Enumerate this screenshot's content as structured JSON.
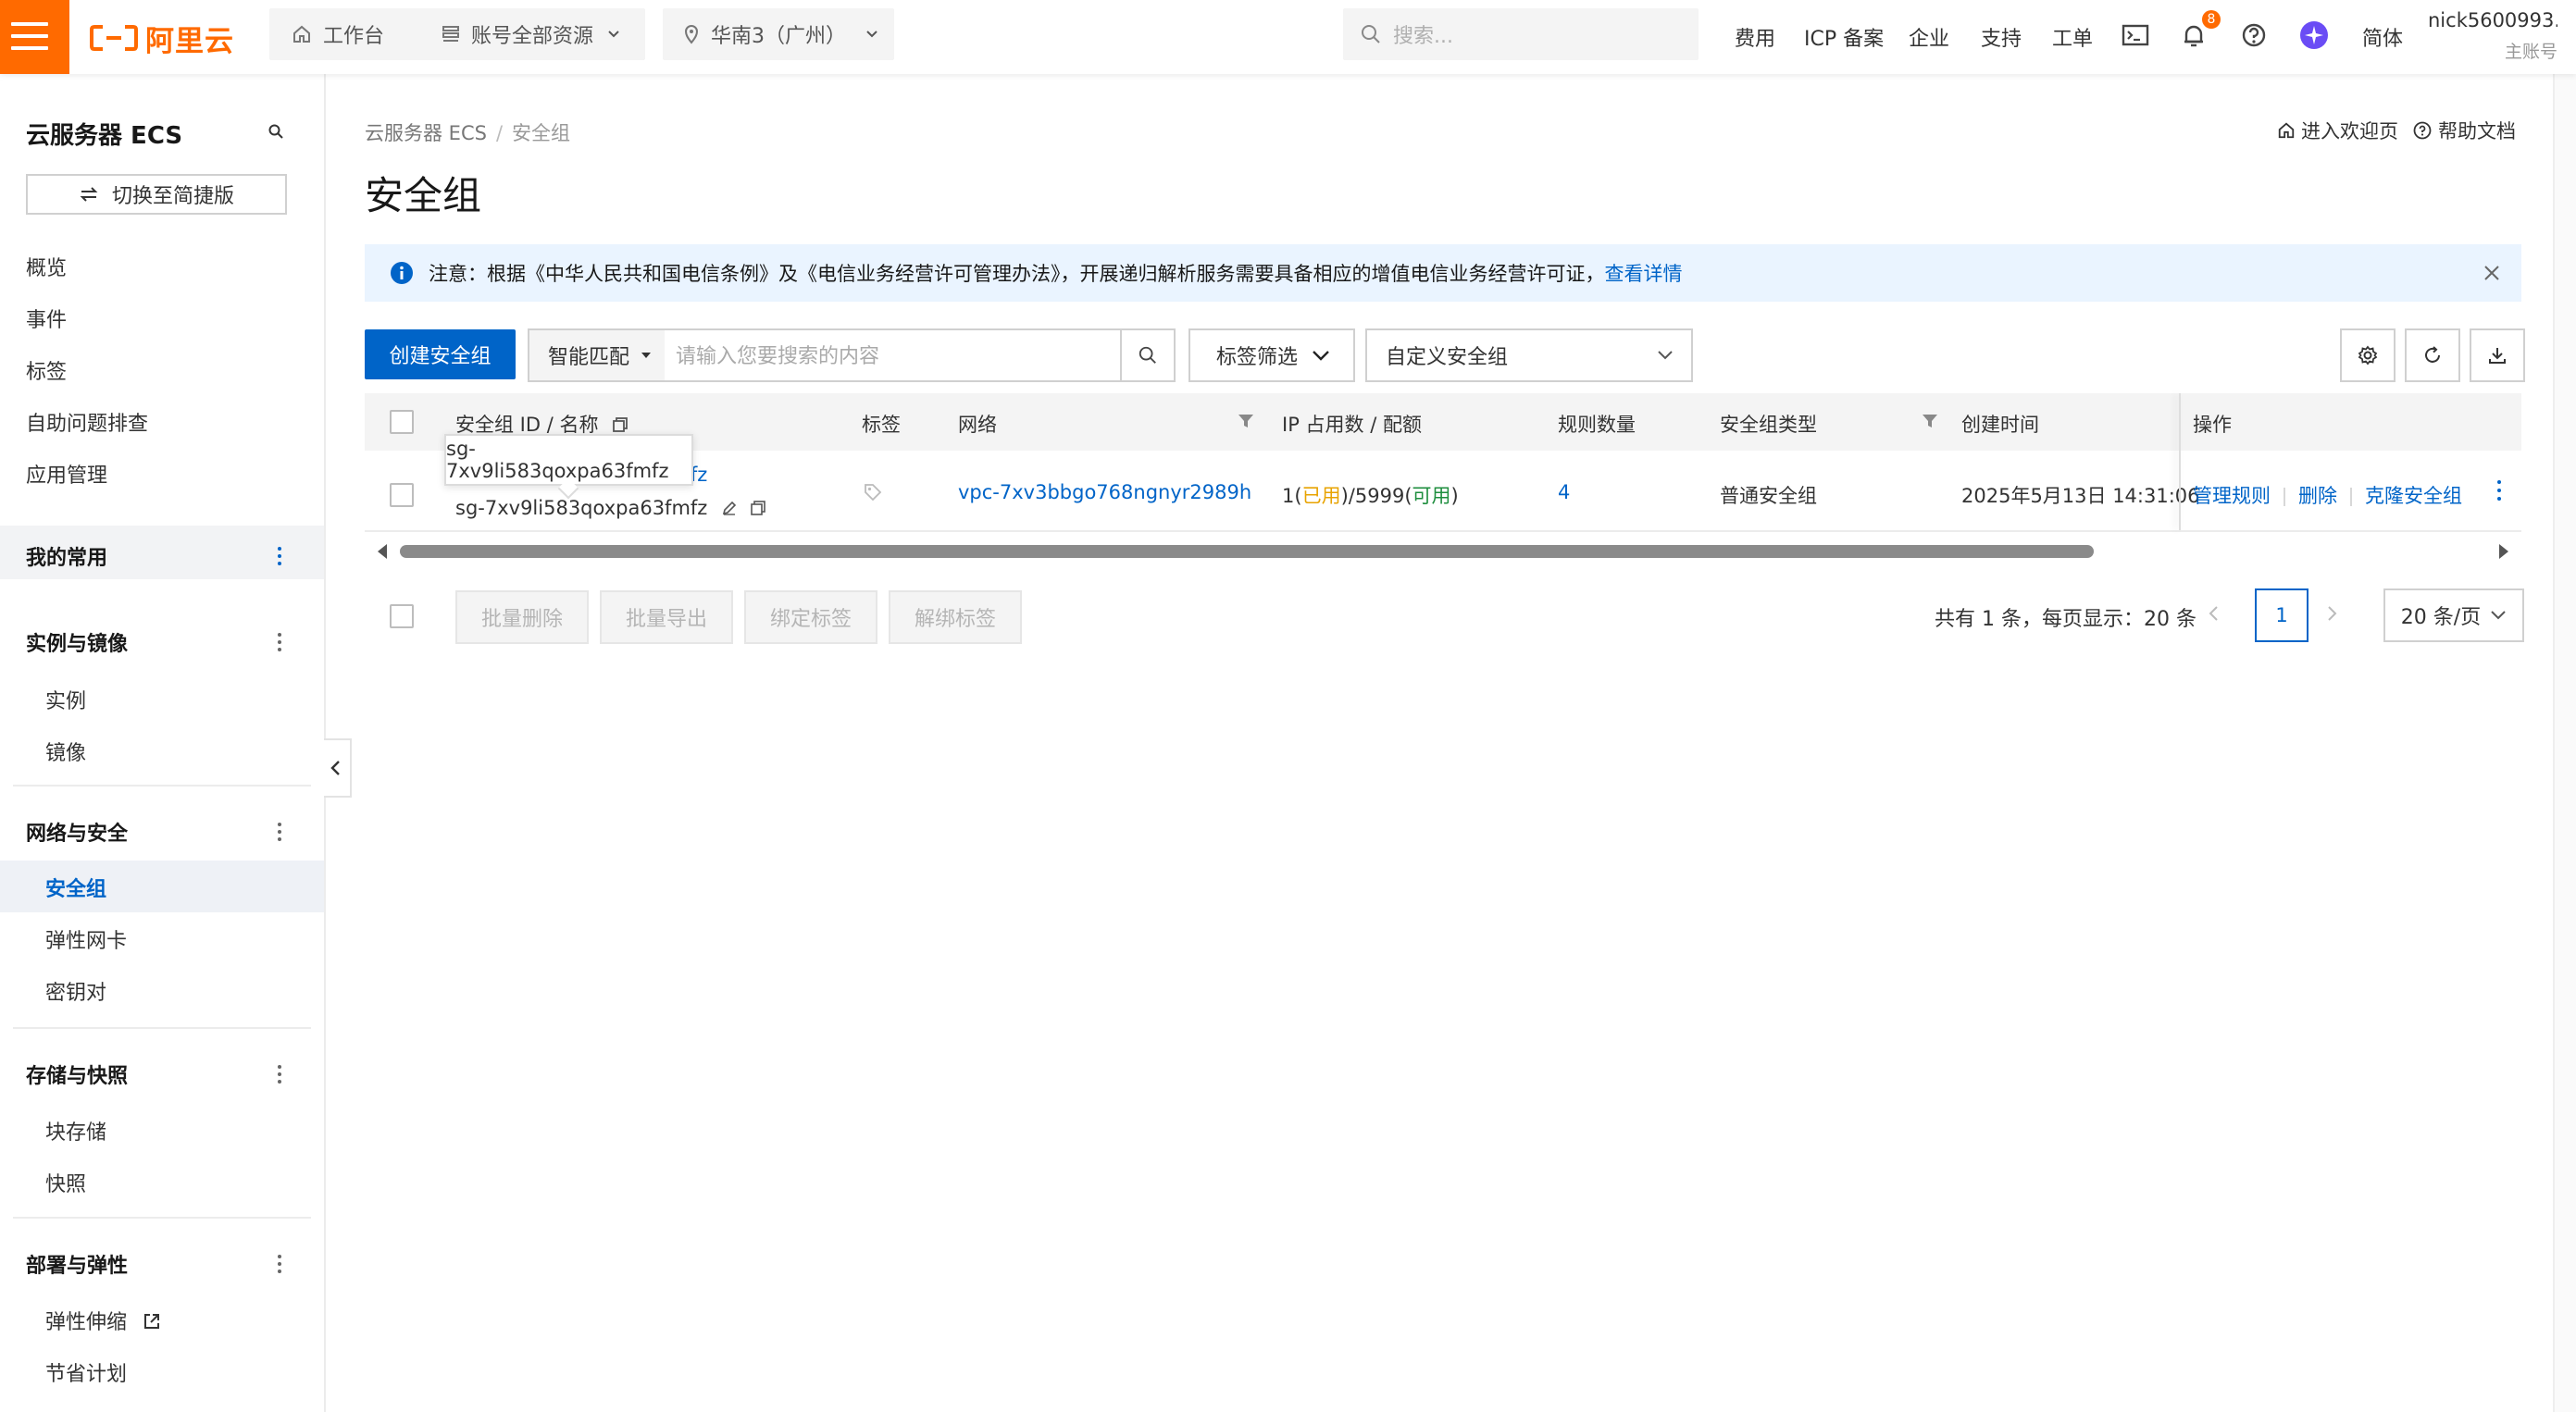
{
  "topbar": {
    "logo_text": "阿里云",
    "workbench": "工作台",
    "resources": "账号全部资源",
    "region": "华南3（广州）",
    "search_placeholder": "搜索...",
    "links": [
      "费用",
      "ICP 备案",
      "企业",
      "支持",
      "工单"
    ],
    "notification_count": "8",
    "language": "简体",
    "user_name": "nick5600993...",
    "user_role": "主账号",
    "brand_color": "#ff6a00"
  },
  "sidebar": {
    "title": "云服务器 ECS",
    "switch_label": "切换至简捷版",
    "top_items": [
      "概览",
      "事件",
      "标签",
      "自助问题排查",
      "应用管理"
    ],
    "favorites": "我的常用",
    "groups": [
      {
        "title": "实例与镜像",
        "items": [
          "实例",
          "镜像"
        ]
      },
      {
        "title": "网络与安全",
        "items": [
          "安全组",
          "弹性网卡",
          "密钥对"
        ]
      },
      {
        "title": "存储与快照",
        "items": [
          "块存储",
          "快照"
        ]
      },
      {
        "title": "部署与弹性",
        "items": [
          "弹性伸缩",
          "节省计划"
        ]
      }
    ],
    "active_item": "安全组"
  },
  "breadcrumb": {
    "root": "云服务器 ECS",
    "current": "安全组"
  },
  "page_title": "安全组",
  "header_links": {
    "welcome": "进入欢迎页",
    "help": "帮助文档"
  },
  "notice": {
    "text": "注意：根据《中华人民共和国电信条例》及《电信业务经营许可管理办法》，开展递归解析服务需要具备相应的增值电信业务经营许可证，",
    "link": "查看详情"
  },
  "toolbar": {
    "create": "创建安全组",
    "match_mode": "智能匹配",
    "search_placeholder": "请输入您要搜索的内容",
    "tag_filter": "标签筛选",
    "custom_sg": "自定义安全组"
  },
  "table": {
    "headers": [
      "安全组 ID / 名称",
      "标签",
      "网络",
      "IP 占用数 / 配额",
      "规则数量",
      "安全组类型",
      "创建时间",
      "操作"
    ],
    "row": {
      "name": "sg-7xv9li583qoxpa63fmfz",
      "vpc": "vpc-7xv3bbgo768ngnyr2989h",
      "ip_used": "1",
      "ip_used_label": "已用",
      "ip_quota": "5999",
      "ip_quota_label": "可用",
      "rule_count": "4",
      "type": "普通安全组",
      "created": "2025年5月13日 14:31:06",
      "actions": [
        "管理规则",
        "删除",
        "克隆安全组"
      ]
    },
    "tooltip": "sg-7xv9li583qoxpa63fmfz"
  },
  "batch": {
    "delete": "批量删除",
    "export": "批量导出",
    "bind_tag": "绑定标签",
    "unbind_tag": "解绑标签"
  },
  "pagination": {
    "total_text": "共有 1 条，每页显示：20 条",
    "current_page": "1",
    "page_size": "20 条/页"
  }
}
